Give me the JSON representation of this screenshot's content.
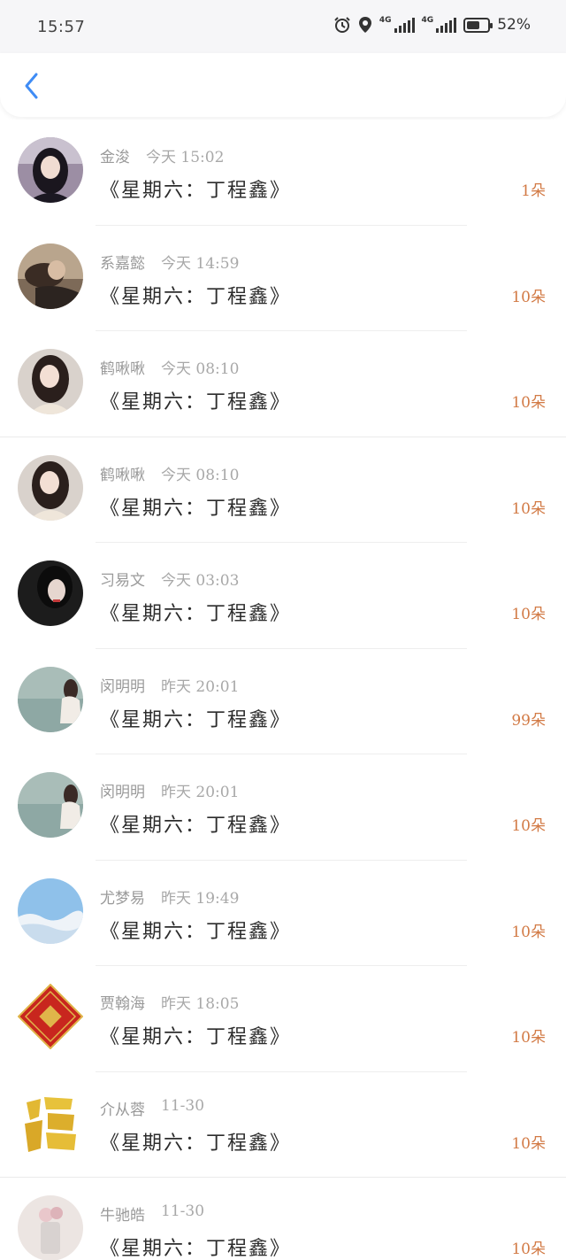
{
  "status_bar": {
    "time": "15:57",
    "network1": "4G",
    "network2": "4G",
    "battery": "52%"
  },
  "header": {
    "back_icon": "chevron-left-icon"
  },
  "colors": {
    "accent": "#3f8cf5",
    "count": "#d27a45"
  },
  "items": [
    {
      "name": "金浚",
      "time": "今天 15:02",
      "title": "《星期六：丁程鑫》",
      "count": "1朵"
    },
    {
      "name": "系嘉懿",
      "time": "今天 14:59",
      "title": "《星期六：丁程鑫》",
      "count": "10朵"
    },
    {
      "name": "鹤啾啾",
      "time": "今天 08:10",
      "title": "《星期六：丁程鑫》",
      "count": "10朵"
    },
    {
      "name": "鹤啾啾",
      "time": "今天 08:10",
      "title": "《星期六：丁程鑫》",
      "count": "10朵"
    },
    {
      "name": "习易文",
      "time": "今天 03:03",
      "title": "《星期六：丁程鑫》",
      "count": "10朵"
    },
    {
      "name": "闵明明",
      "time": "昨天 20:01",
      "title": "《星期六：丁程鑫》",
      "count": "99朵"
    },
    {
      "name": "闵明明",
      "time": "昨天 20:01",
      "title": "《星期六：丁程鑫》",
      "count": "10朵"
    },
    {
      "name": "尤梦易",
      "time": "昨天 19:49",
      "title": "《星期六：丁程鑫》",
      "count": "10朵"
    },
    {
      "name": "贾翰海",
      "time": "昨天 18:05",
      "title": "《星期六：丁程鑫》",
      "count": "10朵"
    },
    {
      "name": "介从蓉",
      "time": "11-30",
      "title": "《星期六：丁程鑫》",
      "count": "10朵"
    },
    {
      "name": "牛驰皓",
      "time": "11-30",
      "title": "《星期六：丁程鑫》",
      "count": "10朵"
    }
  ]
}
